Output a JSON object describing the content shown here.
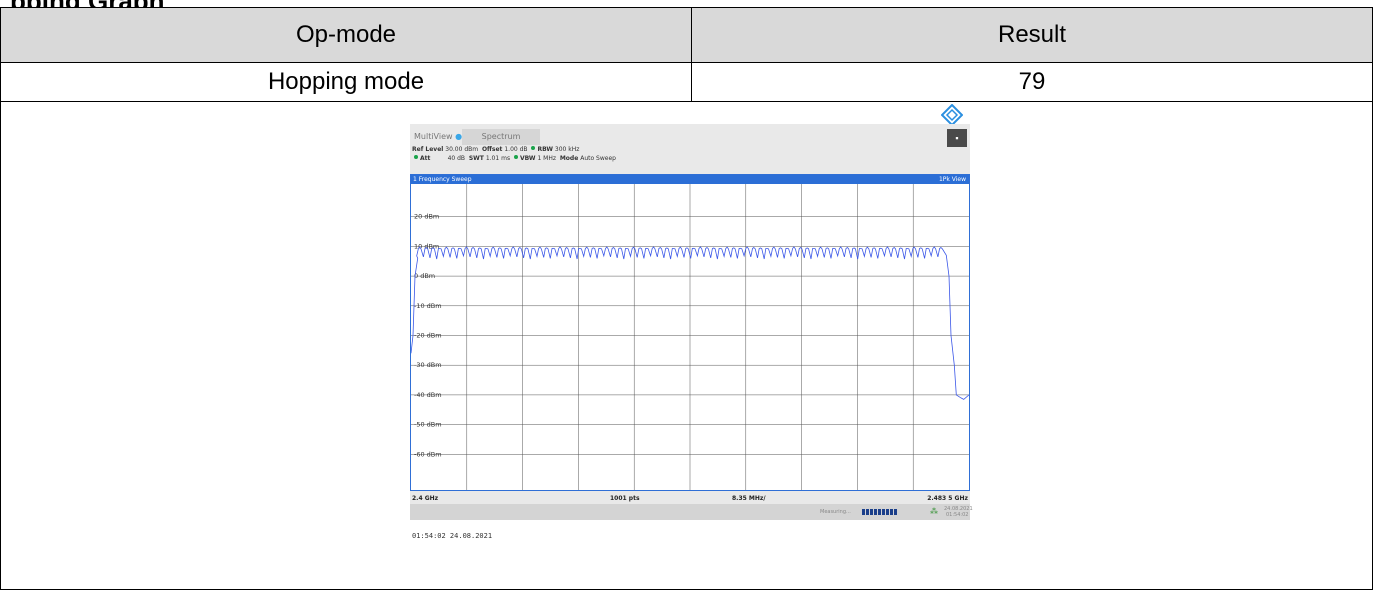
{
  "table": {
    "header": [
      "Op-mode",
      "Result"
    ],
    "row": [
      "Hopping mode",
      "79"
    ]
  },
  "analyzer": {
    "tabs": [
      "MultiView",
      "Spectrum"
    ],
    "close_icon": "square-icon",
    "params_line1": {
      "ref_level_label": "Ref Level",
      "ref_level_value": "30.00 dBm",
      "offset_label": "Offset",
      "offset_value": "1.00 dB",
      "rbw_label": "RBW",
      "rbw_value": "300 kHz"
    },
    "params_line2": {
      "att_label": "Att",
      "att_value": "40 dB",
      "swt_label": "SWT",
      "swt_value": "1.01 ms",
      "vbw_label": "VBW",
      "vbw_value": "1 MHz",
      "mode_label": "Mode",
      "mode_value": "Auto Sweep"
    },
    "panel_title": "1 Frequency Sweep",
    "panel_view": "1Pk View",
    "status": {
      "measuring": "Measuring...",
      "date": "24.08.2021",
      "time": "01:54:02"
    },
    "timestamp": "01:54:02  24.08.2021",
    "trace_color": "#3b57e8"
  },
  "chart_data": {
    "type": "line",
    "y_tick_labels": [
      "20 dBm",
      "10 dBm",
      "0 dBm",
      "-10 dBm",
      "-20 dBm",
      "-30 dBm",
      "-40 dBm",
      "-50 dBm",
      "-60 dBm"
    ],
    "y_ticks": [
      20,
      10,
      0,
      -10,
      -20,
      -30,
      -40,
      -50,
      -60
    ],
    "ylim": [
      -70,
      30
    ],
    "xlim": [
      2.4,
      2.4835
    ],
    "x_start_label": "2.4 GHz",
    "x_end_label": "2.483 5 GHz",
    "points_label": "1001 pts",
    "span_per_div_label": "8.35 MHz/",
    "channels": 79,
    "hop_level_dbm": 9,
    "band_start_ghz": 2.4013,
    "band_stop_ghz": 2.4793,
    "noise_floor_dbm": -40,
    "grid": true
  }
}
